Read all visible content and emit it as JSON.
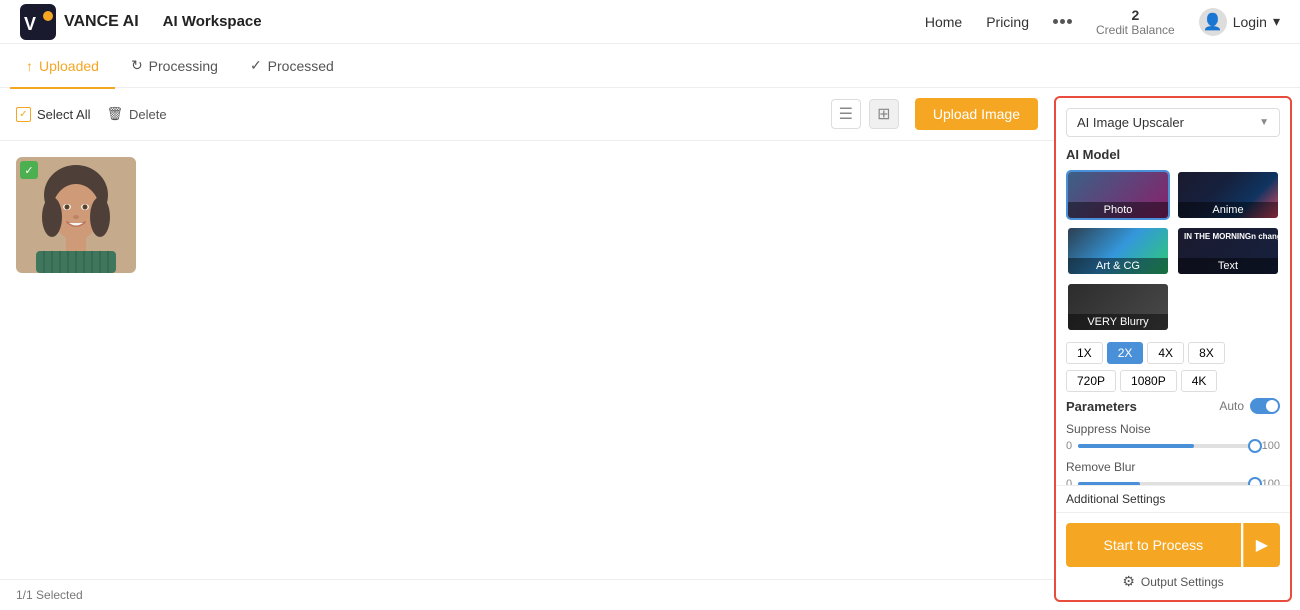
{
  "header": {
    "logo_text": "VANCE AI",
    "workspace_label": "AI Workspace",
    "nav": [
      {
        "label": "Home",
        "id": "home"
      },
      {
        "label": "Pricing",
        "id": "pricing"
      }
    ],
    "credit_balance_label": "Credit Balance",
    "credit_amount": "2",
    "login_label": "Login"
  },
  "tabs": [
    {
      "id": "uploaded",
      "label": "Uploaded",
      "icon": "↑",
      "active": true
    },
    {
      "id": "processing",
      "label": "Processing",
      "icon": "↻",
      "active": false
    },
    {
      "id": "processed",
      "label": "Processed",
      "icon": "✓",
      "active": false
    }
  ],
  "toolbar": {
    "select_all_label": "Select All",
    "delete_label": "Delete",
    "upload_btn_label": "Upload Image"
  },
  "image_area": {
    "status_text": "1/1   Selected"
  },
  "right_panel": {
    "dropdown_label": "AI Image Upscaler",
    "ai_model_title": "AI Model",
    "models": [
      {
        "id": "photo",
        "label": "Photo",
        "active": true,
        "style": "photo"
      },
      {
        "id": "anime",
        "label": "Anime",
        "active": false,
        "style": "anime"
      },
      {
        "id": "artcg",
        "label": "Art & CG",
        "active": false,
        "style": "artcg"
      },
      {
        "id": "text",
        "label": "Text",
        "active": false,
        "style": "text"
      },
      {
        "id": "blurry",
        "label": "VERY Blurry",
        "active": false,
        "style": "blurry",
        "single": true
      }
    ],
    "scale_options": [
      "1X",
      "2X",
      "4X",
      "8X"
    ],
    "scale_active": "2X",
    "resolution_options": [
      "720P",
      "1080P",
      "4K"
    ],
    "params_title": "Parameters",
    "auto_label": "Auto",
    "suppress_noise_label": "Suppress Noise",
    "suppress_noise_min": "0",
    "suppress_noise_max": "100",
    "suppress_noise_value": 65,
    "remove_blur_label": "Remove Blur",
    "remove_blur_min": "0",
    "remove_blur_max": "100",
    "remove_blur_value": 35,
    "additional_settings_label": "Additional Settings",
    "process_btn_label": "Start to Process",
    "output_settings_label": "Output Settings"
  }
}
